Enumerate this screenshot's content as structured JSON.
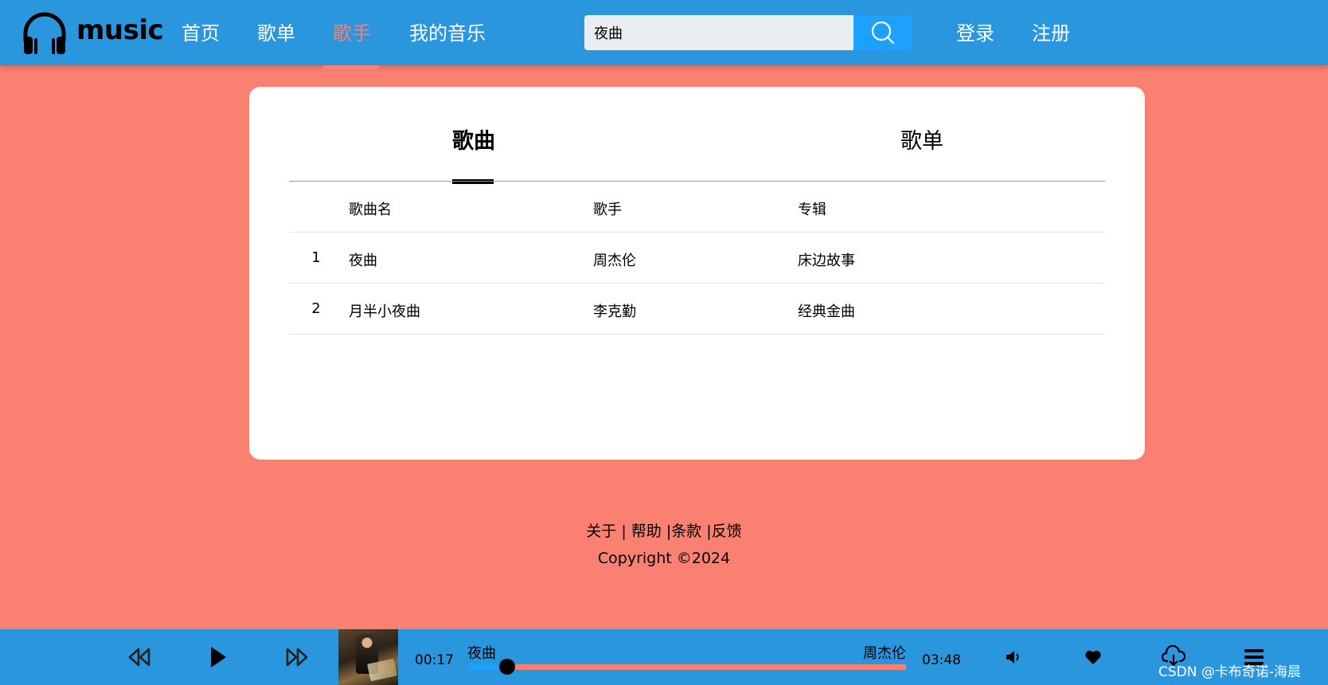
{
  "header": {
    "logo_text": "music",
    "nav": [
      {
        "label": "首页",
        "active": false
      },
      {
        "label": "歌单",
        "active": false
      },
      {
        "label": "歌手",
        "active": true
      },
      {
        "label": "我的音乐",
        "active": false
      }
    ],
    "search": {
      "value": "夜曲"
    },
    "login_label": "登录",
    "register_label": "注册"
  },
  "tabs": [
    {
      "label": "歌曲",
      "active": true
    },
    {
      "label": "歌单",
      "active": false
    }
  ],
  "table": {
    "headers": {
      "name": "歌曲名",
      "artist": "歌手",
      "album": "专辑"
    },
    "rows": [
      {
        "index": "1",
        "name": "夜曲",
        "artist": "周杰伦",
        "album": "床边故事"
      },
      {
        "index": "2",
        "name": "月半小夜曲",
        "artist": "李克勤",
        "album": "经典金曲"
      }
    ]
  },
  "footer": {
    "links": [
      "关于",
      "帮助",
      "条款",
      "反馈"
    ],
    "copyright": "Copyright ©2024"
  },
  "player": {
    "current_time": "00:17",
    "total_time": "03:48",
    "song": "夜曲",
    "artist": "周杰伦",
    "progress": 0.09
  },
  "watermark": "CSDN @卡布奇诺-海晨",
  "colors": {
    "header_bg": "#2a96dd",
    "page_bg": "#fa8072",
    "accent": "#fa8072",
    "search_button": "#1ea0ff",
    "progress_fill": "#1ea0ff"
  },
  "icons": [
    "headphones-icon",
    "search-icon",
    "rewind-icon",
    "play-icon",
    "fast-forward-icon",
    "volume-icon",
    "heart-icon",
    "cloud-download-icon",
    "playlist-icon"
  ]
}
